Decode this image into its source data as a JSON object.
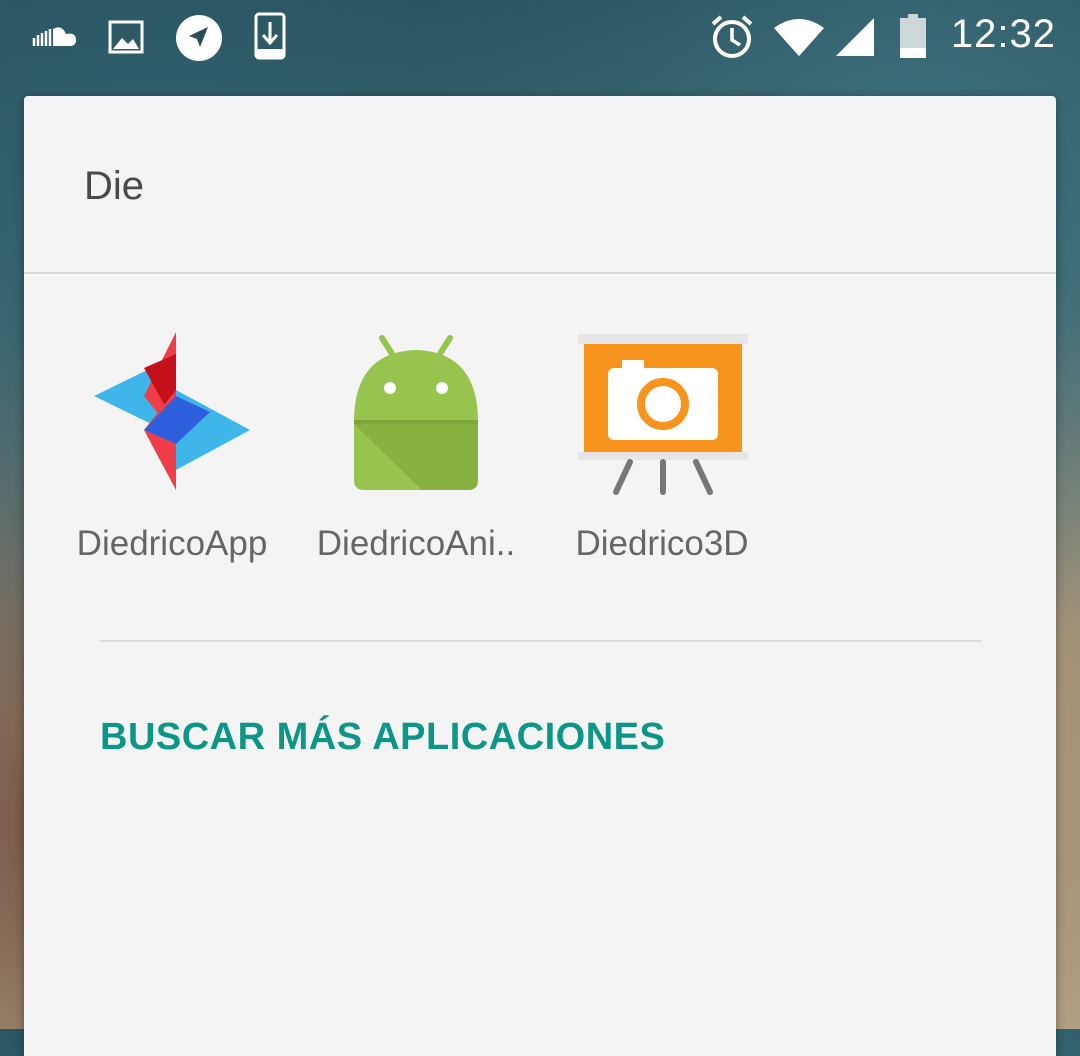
{
  "status_bar": {
    "time": "12:32",
    "left_icons": [
      "soundcloud-icon",
      "image-icon",
      "navigation-icon",
      "download-icon"
    ],
    "right_icons": [
      "alarm-icon",
      "wifi-icon",
      "cell-signal-icon",
      "battery-icon"
    ]
  },
  "search": {
    "query": "Die"
  },
  "apps": [
    {
      "label": "DiedricoApp",
      "icon": "diedricoapp-logo-icon"
    },
    {
      "label": "DiedricoAni..",
      "icon": "android-robot-icon"
    },
    {
      "label": "Diedrico3D",
      "icon": "camera-easel-icon"
    }
  ],
  "actions": {
    "more_apps_label": "BUSCAR MÁS APLICACIONES"
  },
  "colors": {
    "accent": "#0b9688",
    "dialog_bg": "#f4f4f4",
    "android_green": "#97c34f",
    "diedrico3d_orange": "#f7941d"
  }
}
